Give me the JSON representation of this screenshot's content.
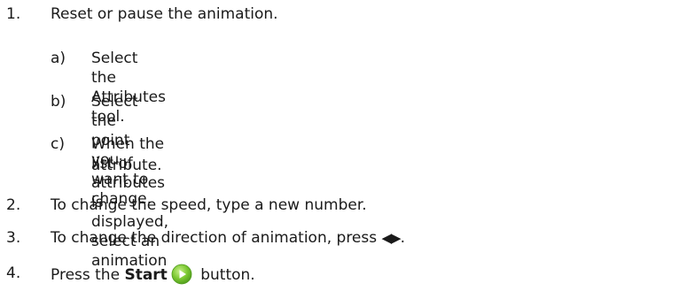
{
  "steps": [
    {
      "number": "1.",
      "text": "Reset or pause the animation."
    },
    {
      "number": "2.",
      "text": "To change the speed, type a new number."
    },
    {
      "number": "3.",
      "text_before": "To change the direction of animation, press ",
      "glyph": "◀▶",
      "text_after": "."
    },
    {
      "number": "4.",
      "text_before": "Press the ",
      "bold": "Start",
      "icon": "play-icon",
      "text_after": " button."
    }
  ],
  "substeps": [
    {
      "letter": "a)",
      "text": "Select the Attributes tool."
    },
    {
      "letter": "b)",
      "text": "Select the point you want to change."
    },
    {
      "letter": "c)",
      "line1": "When the list of attributes is displayed, select an animation",
      "line2": "attribute."
    }
  ],
  "colors": {
    "play_icon_fill": "#7cc832",
    "play_icon_edge": "#4e9a1c",
    "text": "#1a1a1a"
  }
}
